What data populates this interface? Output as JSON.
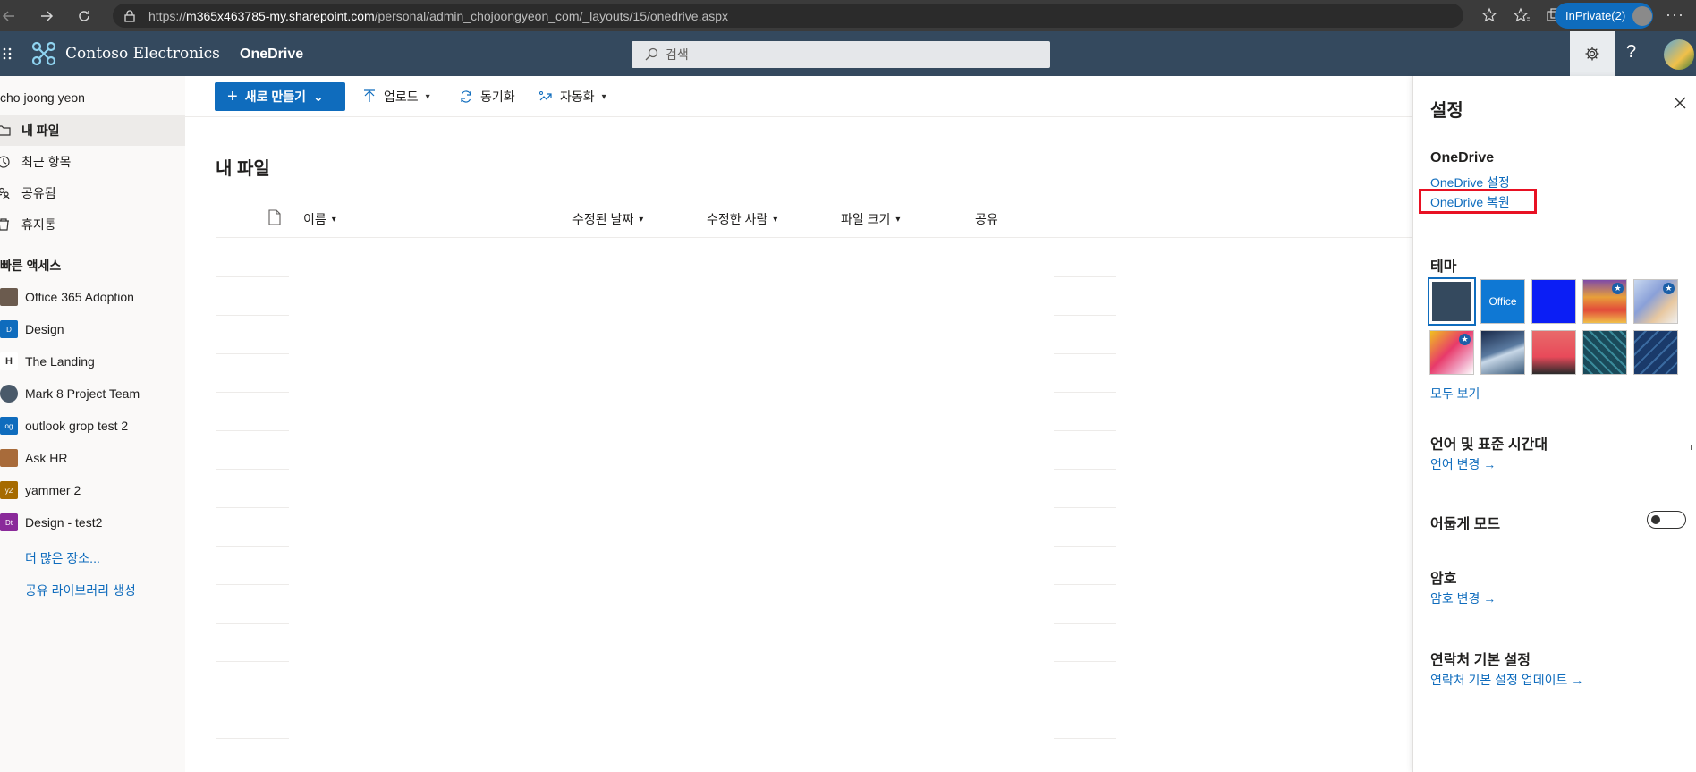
{
  "browser": {
    "url_prefix": "https://",
    "url_host": "m365x463785-my.sharepoint.com",
    "url_path": "/personal/admin_chojoongyeon_com/_layouts/15/onedrive.aspx",
    "inprivate_label": "InPrivate(2)"
  },
  "suite": {
    "brand": "Contoso Electronics",
    "app_name": "OneDrive",
    "search_placeholder": "검색",
    "help": "?"
  },
  "leftnav": {
    "user": "cho joong yeon",
    "items": [
      {
        "label": "내 파일",
        "icon": "folder-icon",
        "active": true
      },
      {
        "label": "최근 항목",
        "icon": "clock-icon",
        "active": false
      },
      {
        "label": "공유됨",
        "icon": "people-icon",
        "active": false
      },
      {
        "label": "휴지통",
        "icon": "trash-icon",
        "active": false
      }
    ],
    "section_label": "빠른 액세스",
    "sites": [
      {
        "label": "Office 365 Adoption",
        "badge": "",
        "color": "#6b5b4e"
      },
      {
        "label": "Design",
        "badge": "D",
        "color": "#0f6cbd"
      },
      {
        "label": "The Landing",
        "badge": "H",
        "color": "#ffffff"
      },
      {
        "label": "Mark 8 Project Team",
        "badge": "",
        "color": "#4a5a6a"
      },
      {
        "label": "outlook grop test 2",
        "badge": "og",
        "color": "#0f6cbd"
      },
      {
        "label": "Ask HR",
        "badge": "",
        "color": "#a86b3a"
      },
      {
        "label": "yammer 2",
        "badge": "y2",
        "color": "#a66b00"
      },
      {
        "label": "Design - test2",
        "badge": "Dt",
        "color": "#8a2a9a"
      }
    ],
    "more_places": "더 많은 장소...",
    "create_library": "공유 라이브러리 생성"
  },
  "cmdbar": {
    "new_label": "새로 만들기",
    "upload_label": "업로드",
    "sync_label": "동기화",
    "automate_label": "자동화"
  },
  "main": {
    "title": "내 파일",
    "columns": {
      "name": "이름",
      "modified": "수정된 날짜",
      "modified_by": "수정한 사람",
      "size": "파일 크기",
      "sharing": "공유"
    }
  },
  "settings": {
    "title": "설정",
    "onedrive_heading": "OneDrive",
    "onedrive_settings": "OneDrive 설정",
    "onedrive_restore": "OneDrive 복원",
    "theme_heading": "테마",
    "theme_office_label": "Office",
    "see_all": "모두 보기",
    "language_heading": "언어 및 표준 시간대",
    "language_link": "언어 변경 →",
    "dark_mode": "어둡게 모드",
    "password_heading": "암호",
    "password_link": "암호 변경 →",
    "contact_heading": "연락처 기본 설정",
    "contact_link": "연락처 기본 설정 업데이트 →"
  },
  "colors": {
    "suite_bar": "#34495e",
    "accent": "#0f6cbd",
    "highlight_box": "#e81123"
  }
}
